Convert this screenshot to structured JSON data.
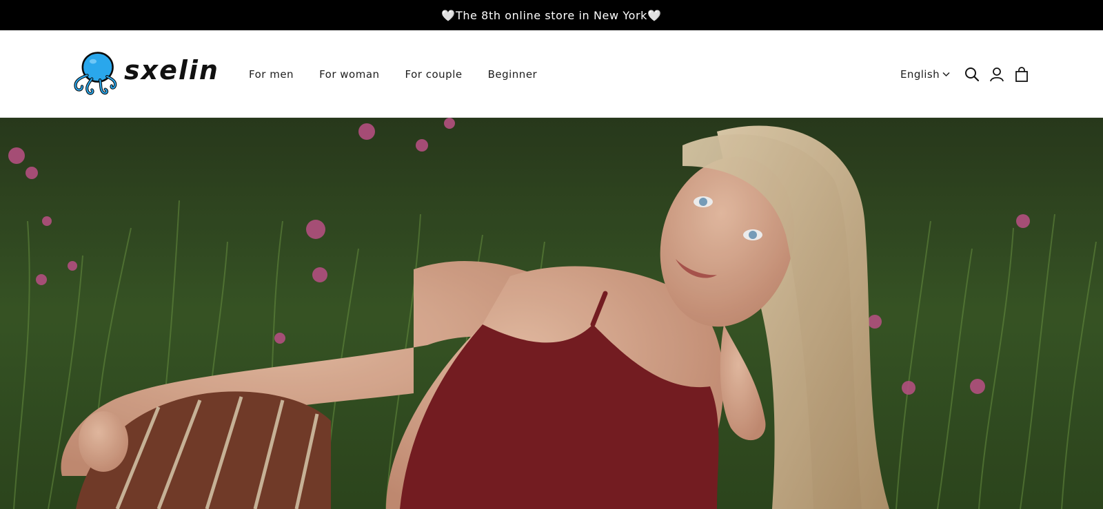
{
  "announcement": {
    "text": "🤍The 8th online store in New York🤍"
  },
  "header": {
    "logo_text": "sxelin",
    "nav": [
      {
        "label": "For men"
      },
      {
        "label": "For woman"
      },
      {
        "label": "For couple"
      },
      {
        "label": "Beginner"
      }
    ],
    "language": "English",
    "icons": [
      "search-icon",
      "account-icon",
      "cart-icon"
    ]
  },
  "hero": {
    "image": "woman-lying-in-meadow",
    "colors": {
      "grass": "#2f4a1f",
      "top": "#7d1f24",
      "hair": "#d8c3a0",
      "skin": "#e6b59b"
    }
  },
  "colors": {
    "announcement_bg": "#000000",
    "logo_accent": "#2aa7ec"
  }
}
